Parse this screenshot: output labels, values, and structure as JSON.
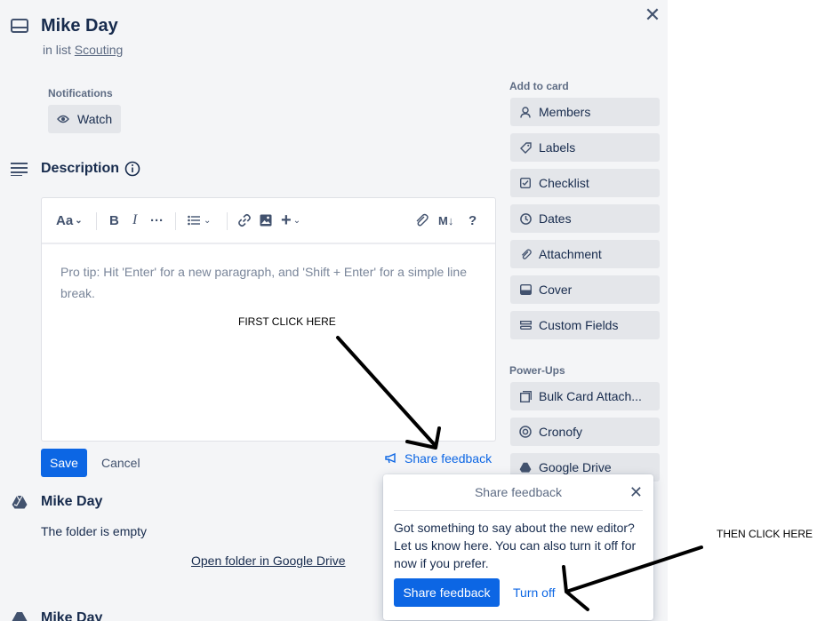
{
  "card": {
    "title": "Mike Day",
    "in_list_prefix": "in list",
    "list_name": "Scouting"
  },
  "notifications": {
    "heading": "Notifications",
    "watch_label": "Watch"
  },
  "description": {
    "heading": "Description",
    "placeholder": "Pro tip: Hit 'Enter' for a new paragraph, and 'Shift + Enter' for a simple line break.",
    "toolbar": {
      "text_style": "Aa",
      "bold": "B",
      "italic": "I",
      "more": "···",
      "markdown": "M↓",
      "help": "?"
    },
    "save_label": "Save",
    "cancel_label": "Cancel",
    "share_feedback_label": "Share feedback"
  },
  "add_to_card": {
    "heading": "Add to card",
    "items": [
      {
        "label": "Members",
        "icon": "person-icon"
      },
      {
        "label": "Labels",
        "icon": "tag-icon"
      },
      {
        "label": "Checklist",
        "icon": "checkbox-icon"
      },
      {
        "label": "Dates",
        "icon": "clock-icon"
      },
      {
        "label": "Attachment",
        "icon": "paperclip-icon"
      },
      {
        "label": "Cover",
        "icon": "cover-icon"
      },
      {
        "label": "Custom Fields",
        "icon": "fields-icon"
      }
    ]
  },
  "power_ups": {
    "heading": "Power-Ups",
    "items": [
      {
        "label": "Bulk Card Attach...",
        "icon": "bulk-attach-icon"
      },
      {
        "label": "Cronofy",
        "icon": "cronofy-icon"
      },
      {
        "label": "Google Drive",
        "icon": "google-drive-icon"
      }
    ]
  },
  "drive_section": {
    "title": "Mike Day",
    "empty_text": "The folder is empty",
    "open_link": "Open folder in Google Drive",
    "second_title": "Mike Day"
  },
  "feedback_popup": {
    "title": "Share feedback",
    "body": "Got something to say about the new editor? Let us know here. You can also turn it off for now if you prefer.",
    "primary_label": "Share feedback",
    "secondary_label": "Turn off"
  },
  "annotations": {
    "first": "FIRST CLICK HERE",
    "second": "THEN CLICK HERE"
  },
  "colors": {
    "accent": "#0c66e4",
    "panel_bg": "#f4f5f7",
    "button_bg": "#e4e6ea"
  }
}
